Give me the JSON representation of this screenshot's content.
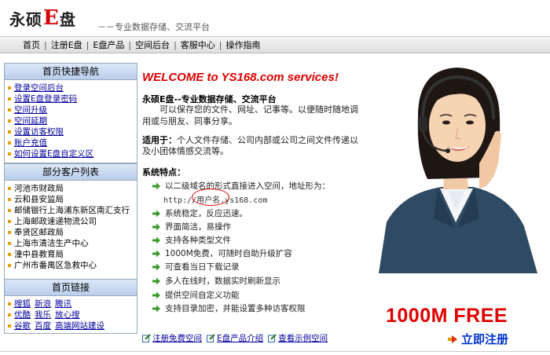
{
  "header": {
    "logo_part1": "永硕",
    "logo_e": "E",
    "logo_part2": "盘",
    "slogan": "－－专业数据存储、交流平台"
  },
  "nav": {
    "items": [
      "首页",
      "注册E盘",
      "E盘产品",
      "空间后台",
      "客服中心",
      "操作指南"
    ],
    "separator": "|"
  },
  "sidebar": {
    "quick_nav": {
      "title": "首页快捷导航",
      "items": [
        "登录空间后台",
        "设置E盘登录密码",
        "空间升级",
        "空间延期",
        "设置访客权限",
        "账户充值",
        "如何设置E盘自定义区"
      ]
    },
    "clients": {
      "title": "部分客户列表",
      "items": [
        "河池市财政局",
        "云和县安监局",
        "邮储银行上海浦东新区南汇支行",
        "上海邮政速递物流公司",
        "奉贤区邮政局",
        "上海市清洁生产中心",
        "潼中县教育局",
        "广州市番禺区急救中心"
      ]
    },
    "links": {
      "title": "首页链接",
      "rows": [
        [
          "搜狐",
          "新浪",
          "腾讯"
        ],
        [
          "优酷",
          "我乐",
          "放心搜"
        ],
        [
          "谷歌",
          "百度",
          "高端网站建设"
        ]
      ]
    }
  },
  "main": {
    "welcome": "WELCOME to YS168.com services!",
    "intro_title": "永硕E盘--专业数据存储、交流平台",
    "intro_body": "可以保存您的文件、网址、记事等。以便随时随地调用或与朋友、同事分享。",
    "suitable_label": "适用于：",
    "suitable_text": "个人文件存储、公司内部或公司之间文件传递以及小团体情感交流等。",
    "features_title": "系统特点：",
    "features": [
      "以二级域名的形式直接进入空间，地址形为：",
      "系统稳定，反应迅速。",
      "界面简洁，易操作",
      "支持各种类型文件",
      "1000M免费，可随时自助升级扩容",
      "可查看当日下载记录",
      "多人在线时，数据实时刷新显示",
      "提供空间自定义功能",
      "支持目录加密，并能设置多种访客权限"
    ],
    "url_prefix": "http://",
    "url_user": "用户名",
    "url_suffix": ".ys168.com"
  },
  "promo": {
    "free_text": "1000M FREE",
    "register_text": "立即注册"
  },
  "bottom_links": [
    "注册免费空间",
    "E盘产品介绍",
    "查看示例空间"
  ],
  "colors": {
    "accent_red": "#e00000",
    "link_blue": "#00009c",
    "bullet_orange": "#e8a000",
    "arrow_green": "#3a9a2a"
  }
}
